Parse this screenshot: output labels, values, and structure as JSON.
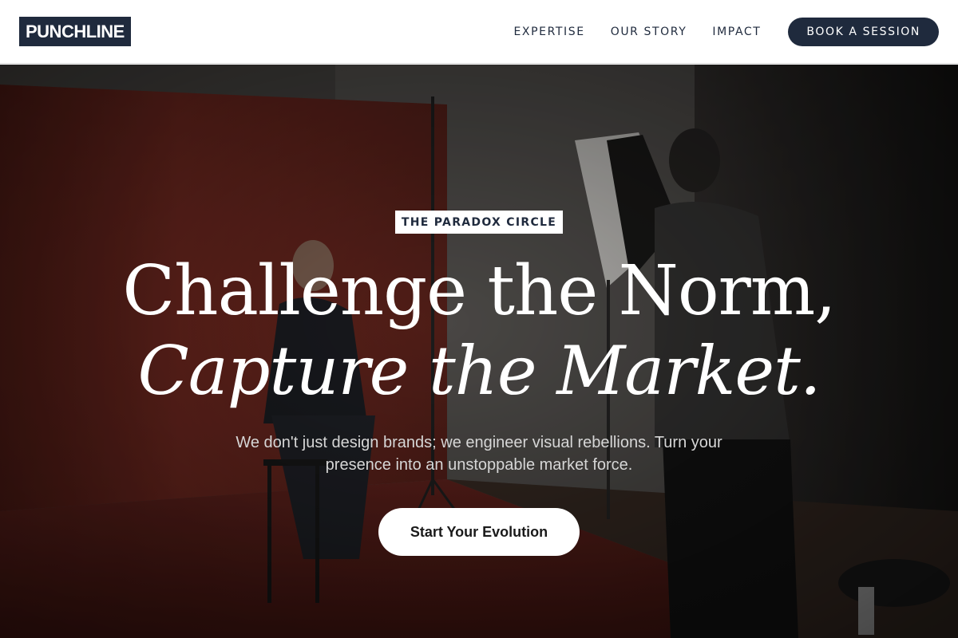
{
  "header": {
    "logo": "PUNCHLINE",
    "nav": [
      {
        "label": "EXPERTISE"
      },
      {
        "label": "OUR STORY"
      },
      {
        "label": "IMPACT"
      }
    ],
    "cta_label": "BOOK A SESSION"
  },
  "hero": {
    "eyebrow": "THE PARADOX CIRCLE",
    "headline_line1": "Challenge the Norm,",
    "headline_line2": "Capture the Market.",
    "subtext": "We don't just design brands; we engineer visual rebellions. Turn your presence into an unstoppable market force.",
    "cta_label": "Start Your Evolution"
  },
  "colors": {
    "brand_navy": "#1f2a3d",
    "white": "#ffffff",
    "backdrop_red": "#7a2a22"
  }
}
